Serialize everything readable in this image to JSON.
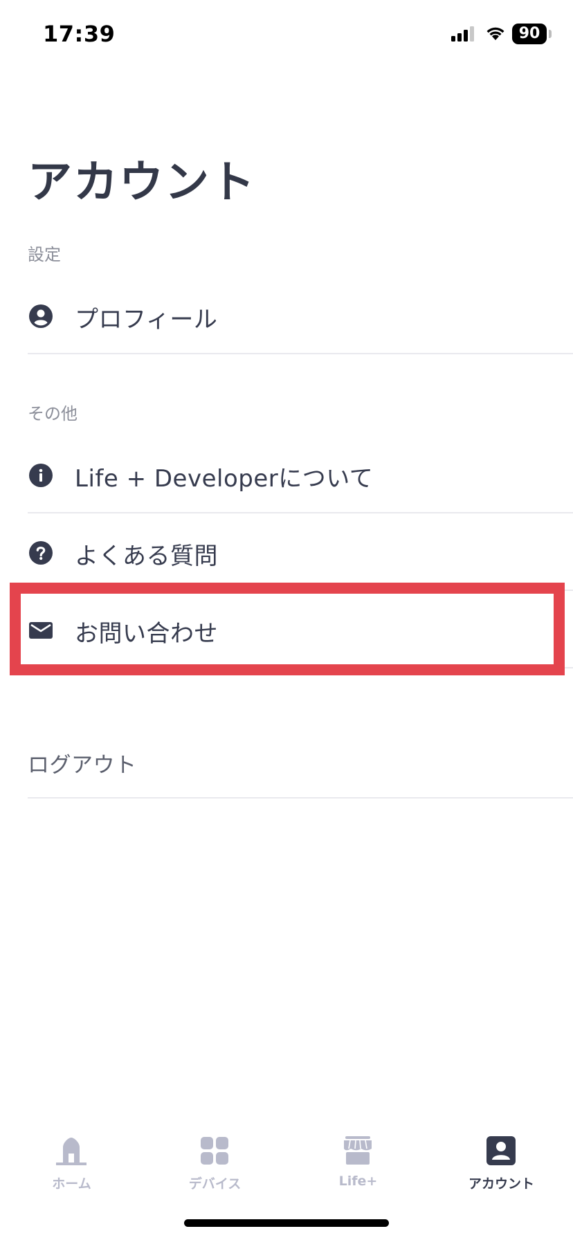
{
  "status_bar": {
    "time": "17:39",
    "battery": "90"
  },
  "title": "アカウント",
  "sections": {
    "settings_label": "設定",
    "other_label": "その他"
  },
  "rows": {
    "profile": {
      "label": "プロフィール",
      "icon": "person-circle-icon"
    },
    "about": {
      "label": "Life + Developerについて",
      "icon": "info-circle-icon"
    },
    "faq": {
      "label": "よくある質問",
      "icon": "question-circle-icon"
    },
    "contact": {
      "label": "お問い合わせ",
      "icon": "envelope-icon"
    }
  },
  "logout_label": "ログアウト",
  "tabbar": {
    "tabs": [
      {
        "label": "ホーム",
        "icon": "home-icon",
        "active": false
      },
      {
        "label": "デバイス",
        "icon": "grid-icon",
        "active": false
      },
      {
        "label": "Life+",
        "icon": "store-icon",
        "active": false
      },
      {
        "label": "アカウント",
        "icon": "account-icon",
        "active": true
      }
    ]
  },
  "colors": {
    "text": "#363b4e",
    "muted": "#8b8e99",
    "tab_inactive": "#b8bacb",
    "highlight": "#e4444d",
    "divider": "#e9e9ee"
  }
}
